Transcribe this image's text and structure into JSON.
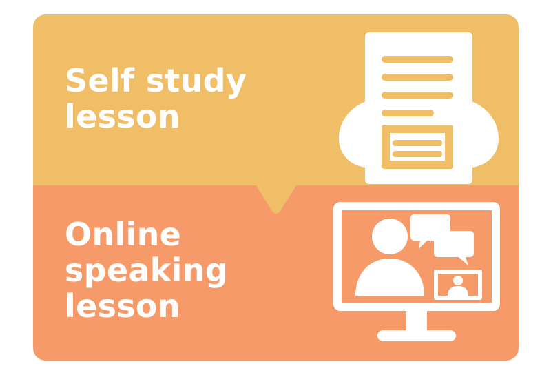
{
  "colors": {
    "top_panel": "#F1BE68",
    "bottom_panel": "#F59A68",
    "text": "#FFFFFF"
  },
  "sections": [
    {
      "label": "Self study\nlesson",
      "icon": "study-document-icon"
    },
    {
      "label": "Online\nspeaking\nlesson",
      "icon": "video-call-monitor-icon"
    }
  ]
}
